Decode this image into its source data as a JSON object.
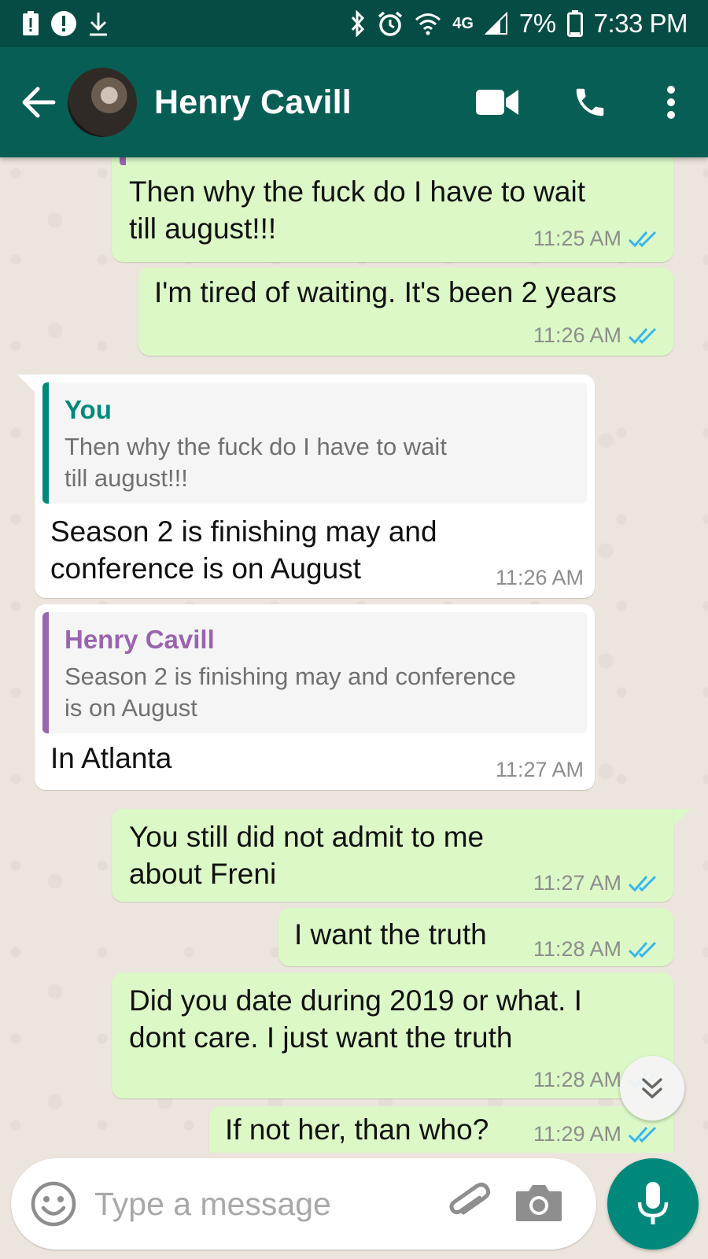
{
  "status_bar": {
    "battery": "7%",
    "time": "7:33 PM",
    "network": "4G",
    "icons": [
      "battery-alert-icon",
      "alert-icon",
      "download-icon",
      "bluetooth-icon",
      "alarm-icon",
      "wifi-icon",
      "signal-icon",
      "battery-icon"
    ]
  },
  "header": {
    "contact_name": "Henry Cavill",
    "icons": [
      "back-arrow-icon",
      "video-call-icon",
      "phone-icon",
      "more-vert-icon"
    ]
  },
  "messages": [
    {
      "direction": "out",
      "text": "Then why the fuck do I have to wait till august!!!",
      "lines": [
        "Then why the fuck do I have to wait",
        "till august!!!"
      ],
      "time": "11:25 AM",
      "read": true
    },
    {
      "direction": "out",
      "text": "I'm tired of waiting. It's been 2 years",
      "lines": [
        "I'm tired of waiting. It's been 2 years"
      ],
      "time": "11:26 AM",
      "read": true
    },
    {
      "direction": "in",
      "quote": {
        "author": "You",
        "lines": [
          "Then why the fuck do I have to wait",
          "till august!!!"
        ]
      },
      "lines": [
        "Season 2 is finishing may and",
        "conference is on August"
      ],
      "time": "11:26 AM"
    },
    {
      "direction": "in",
      "quote": {
        "author": "Henry Cavill",
        "lines": [
          "Season 2 is finishing may and conference",
          "is on August"
        ]
      },
      "lines": [
        "In Atlanta"
      ],
      "time": "11:27 AM"
    },
    {
      "direction": "out",
      "lines": [
        "You still did not admit to me",
        "about Freni"
      ],
      "time": "11:27 AM",
      "read": true
    },
    {
      "direction": "out",
      "lines": [
        "I want the truth"
      ],
      "time": "11:28 AM",
      "read": true
    },
    {
      "direction": "out",
      "lines": [
        "Did you date during 2019 or what. I",
        "dont care. I just want the truth"
      ],
      "time": "11:28 AM",
      "read": true
    },
    {
      "direction": "out",
      "lines": [
        "If not her, than who?"
      ],
      "time": "11:29 AM",
      "read": true
    }
  ],
  "input": {
    "placeholder": "Type a message",
    "icons": [
      "emoji-icon",
      "attach-icon",
      "camera-icon",
      "mic-icon",
      "scroll-down-icon"
    ]
  },
  "colors": {
    "status_bar": "#054d44",
    "app_bar": "#075e54",
    "outgoing_bubble": "#dcf8c6",
    "incoming_bubble": "#ffffff",
    "read_ticks": "#34b7f1",
    "quote_you": "#00897b",
    "quote_contact": "#9c64b0",
    "mic_button": "#00897b"
  }
}
